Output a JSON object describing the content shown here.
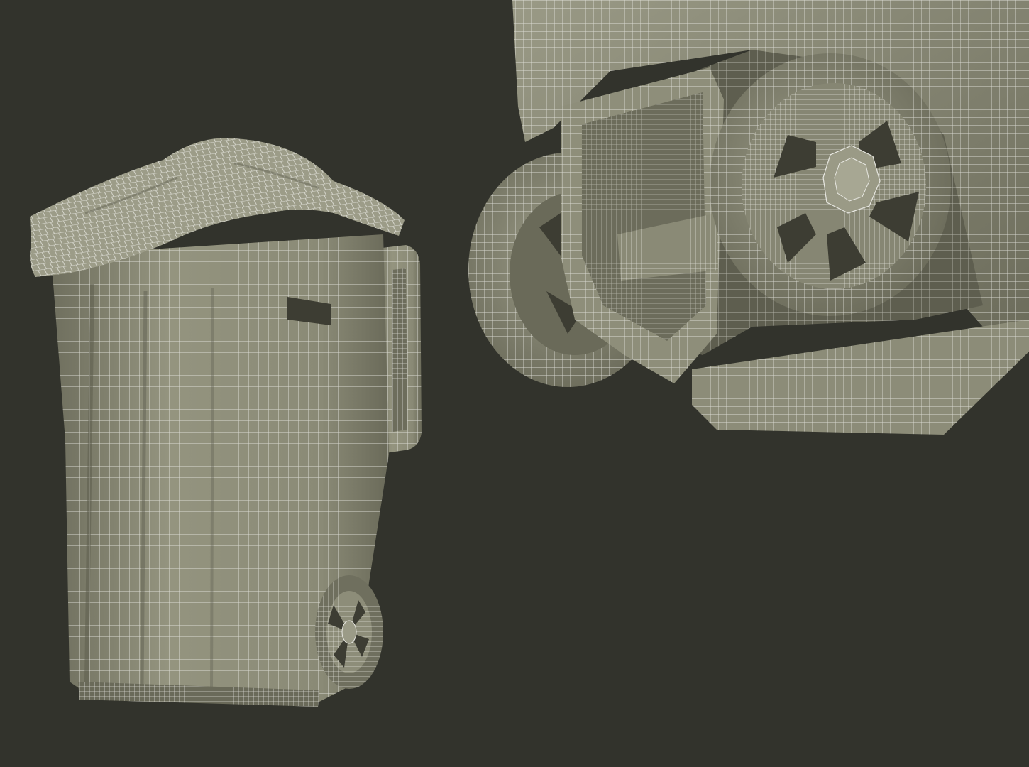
{
  "scene": {
    "background_color": "#32332c",
    "mesh_fill_color": "#8a8a76",
    "mesh_shadow_color": "#5e5e4f",
    "mesh_light_color": "#a7a793",
    "wireframe_color": "#e8e8e2",
    "hole_color": "#3d3d33"
  },
  "views": [
    {
      "name": "full-bin-view",
      "subject": "trash-bin-with-bag-wireframe"
    },
    {
      "name": "wheel-closeup-view",
      "subject": "bin-wheel-axle-wireframe"
    }
  ]
}
